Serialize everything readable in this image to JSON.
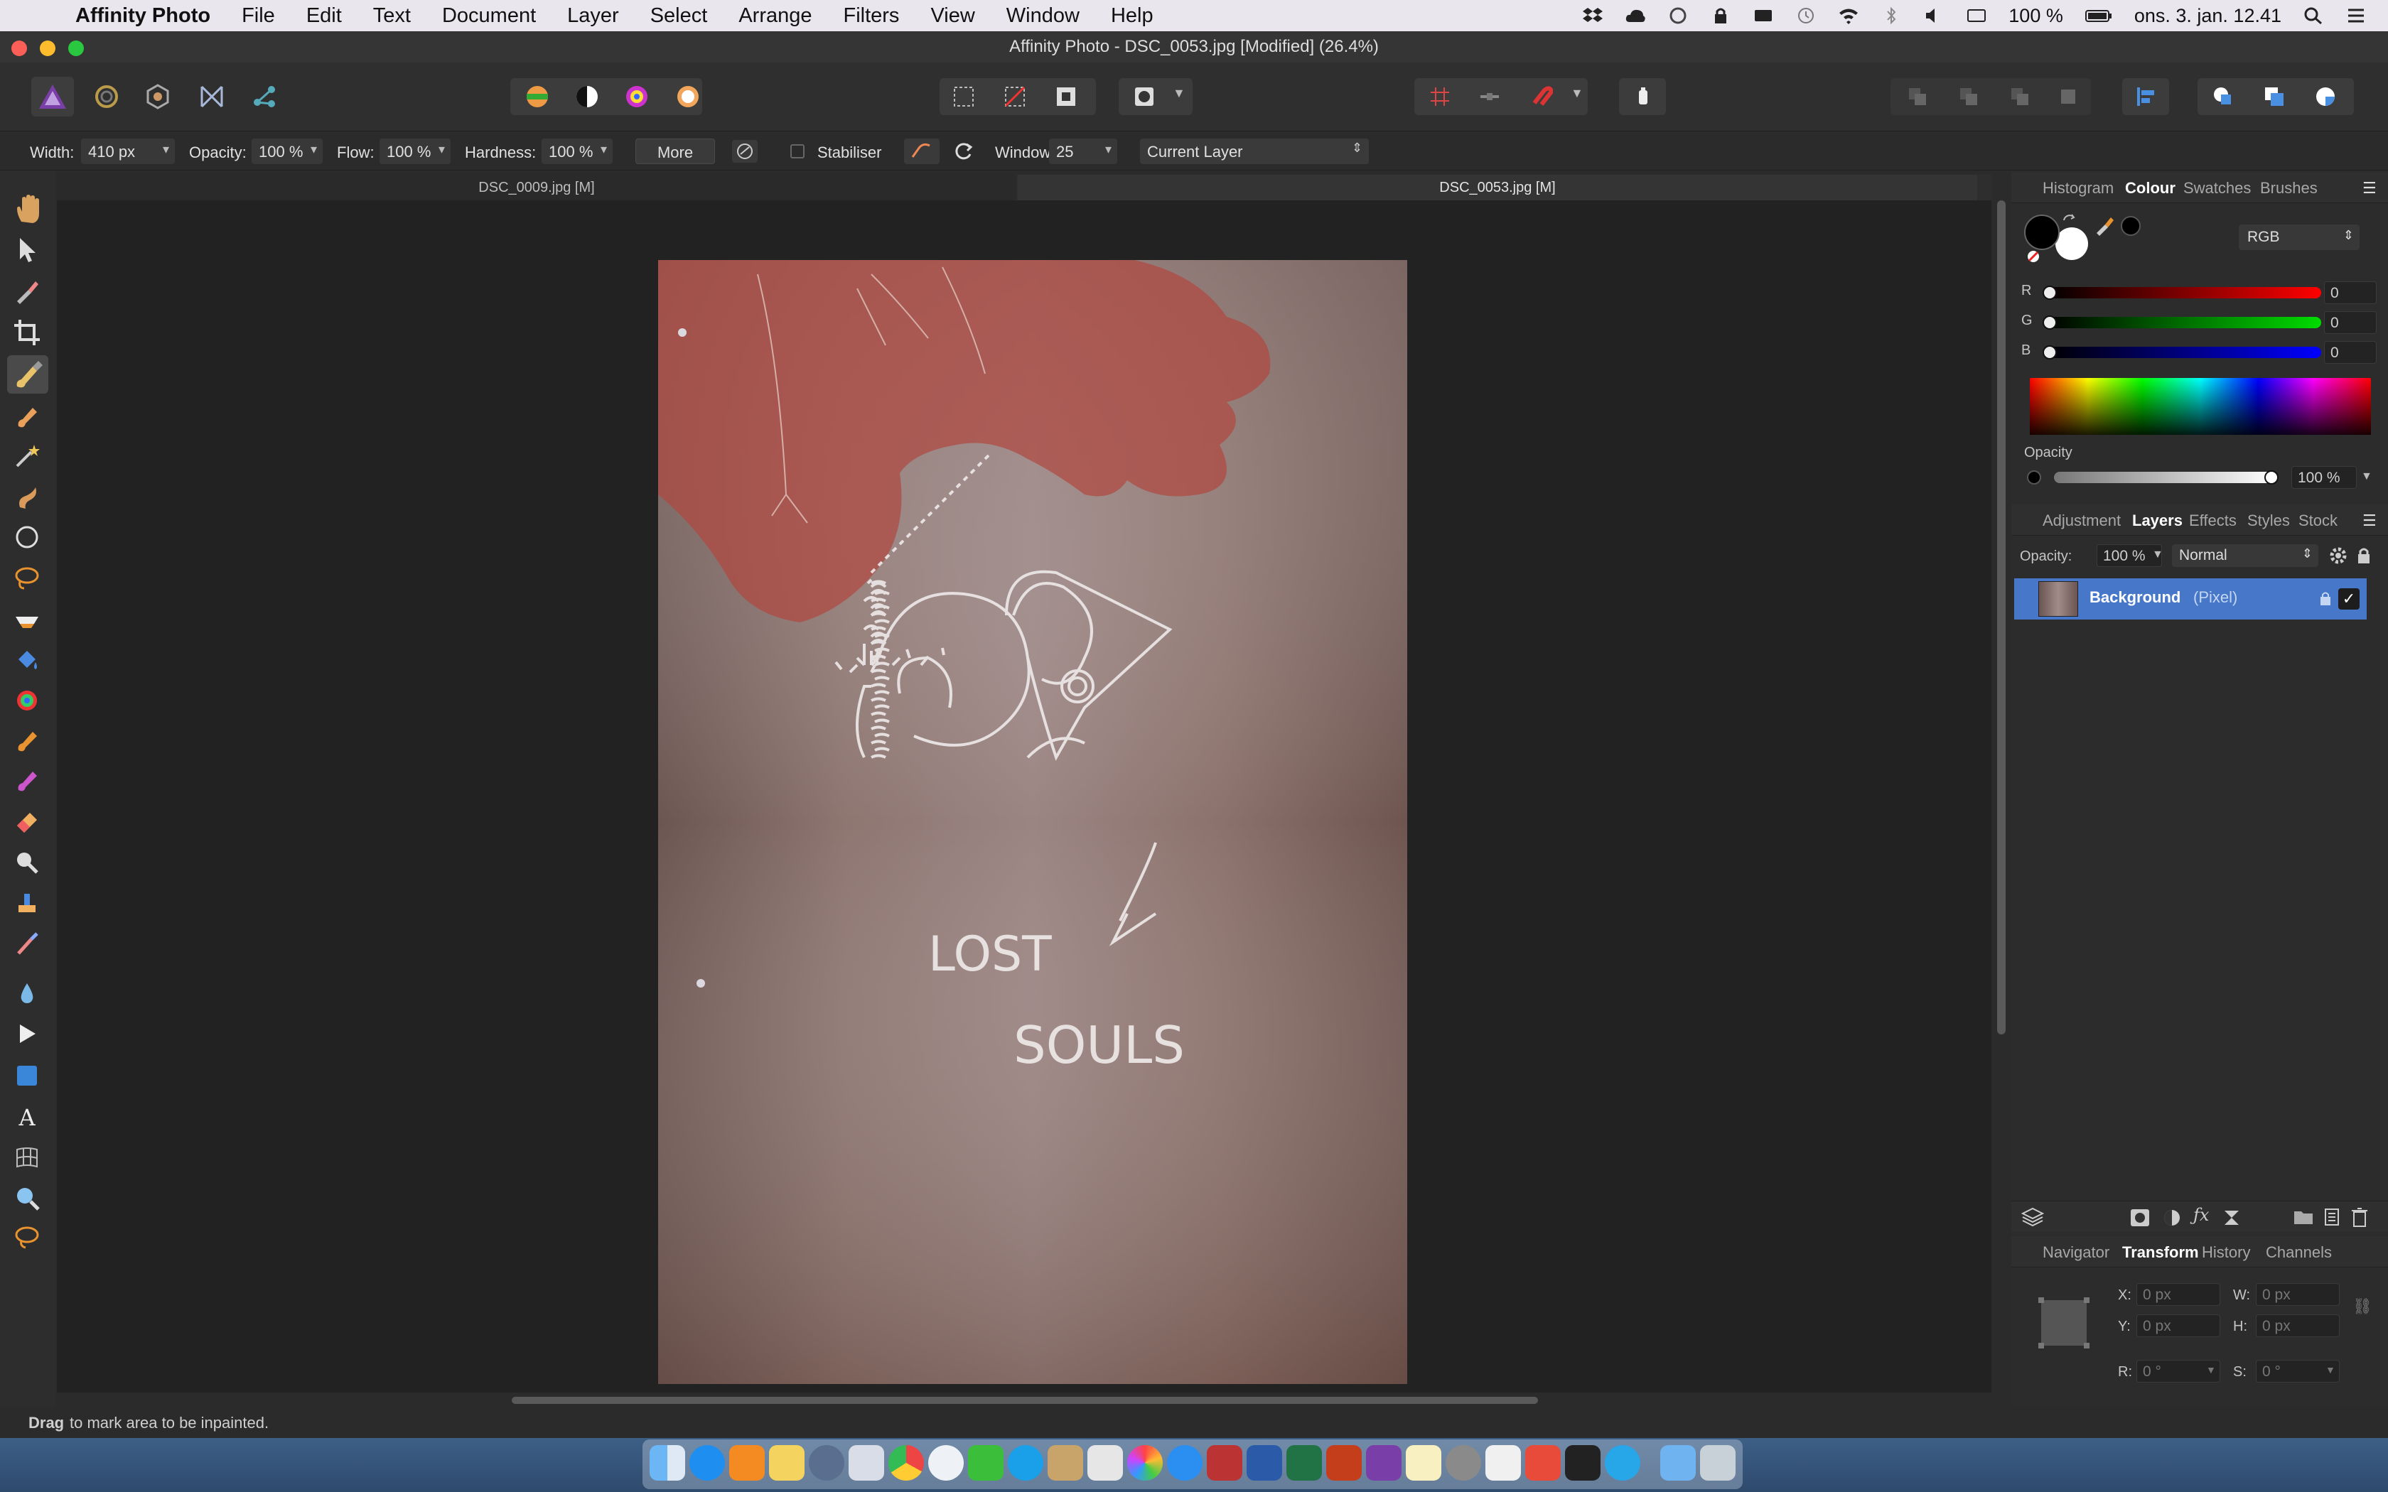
{
  "menubar": {
    "app": "Affinity Photo",
    "items": [
      "File",
      "Edit",
      "Text",
      "Document",
      "Layer",
      "Select",
      "Arrange",
      "Filters",
      "View",
      "Window",
      "Help"
    ],
    "battery": "100 %",
    "clock": "ons. 3. jan. 12.41"
  },
  "window": {
    "title": "Affinity Photo - DSC_0053.jpg [Modified] (26.4%)"
  },
  "context": {
    "width_label": "Width:",
    "width_value": "410 px",
    "opacity_label": "Opacity:",
    "opacity_value": "100 %",
    "flow_label": "Flow:",
    "flow_value": "100 %",
    "hardness_label": "Hardness:",
    "hardness_value": "100 %",
    "more_label": "More",
    "stabiliser_label": "Stabiliser",
    "window_label": "Window:",
    "window_value": "25",
    "source_value": "Current Layer"
  },
  "tabs": [
    {
      "label": "DSC_0009.jpg [M]"
    },
    {
      "label": "DSC_0053.jpg [M]"
    }
  ],
  "photo": {
    "graffiti_line1": "LOST",
    "graffiti_line2": "SOULS"
  },
  "status": {
    "bold": "Drag",
    "text": " to mark area to be inpainted."
  },
  "colour_panel": {
    "tabs": [
      "Histogram",
      "Colour",
      "Swatches",
      "Brushes"
    ],
    "active": "Colour",
    "mode": "RGB",
    "r_label": "R",
    "r_value": "0",
    "g_label": "G",
    "g_value": "0",
    "b_label": "B",
    "b_value": "0",
    "opacity_label": "Opacity",
    "opacity_value": "100 %"
  },
  "layers_panel": {
    "tabs": [
      "Adjustment",
      "Layers",
      "Effects",
      "Styles",
      "Stock"
    ],
    "active": "Layers",
    "opacity_label": "Opacity:",
    "opacity_value": "100 %",
    "blend_mode": "Normal",
    "layer_name": "Background",
    "layer_type": "(Pixel)"
  },
  "transform_panel": {
    "tabs": [
      "Navigator",
      "Transform",
      "History",
      "Channels"
    ],
    "active": "Transform",
    "x_label": "X:",
    "x_value": "0 px",
    "y_label": "Y:",
    "y_value": "0 px",
    "w_label": "W:",
    "w_value": "0 px",
    "h_label": "H:",
    "h_value": "0 px",
    "r_label": "R:",
    "r_value": "0 °",
    "s_label": "S:",
    "s_value": "0 °"
  },
  "colors": {
    "accent": "#4a90e2",
    "selected_layer": "#4677c8"
  }
}
